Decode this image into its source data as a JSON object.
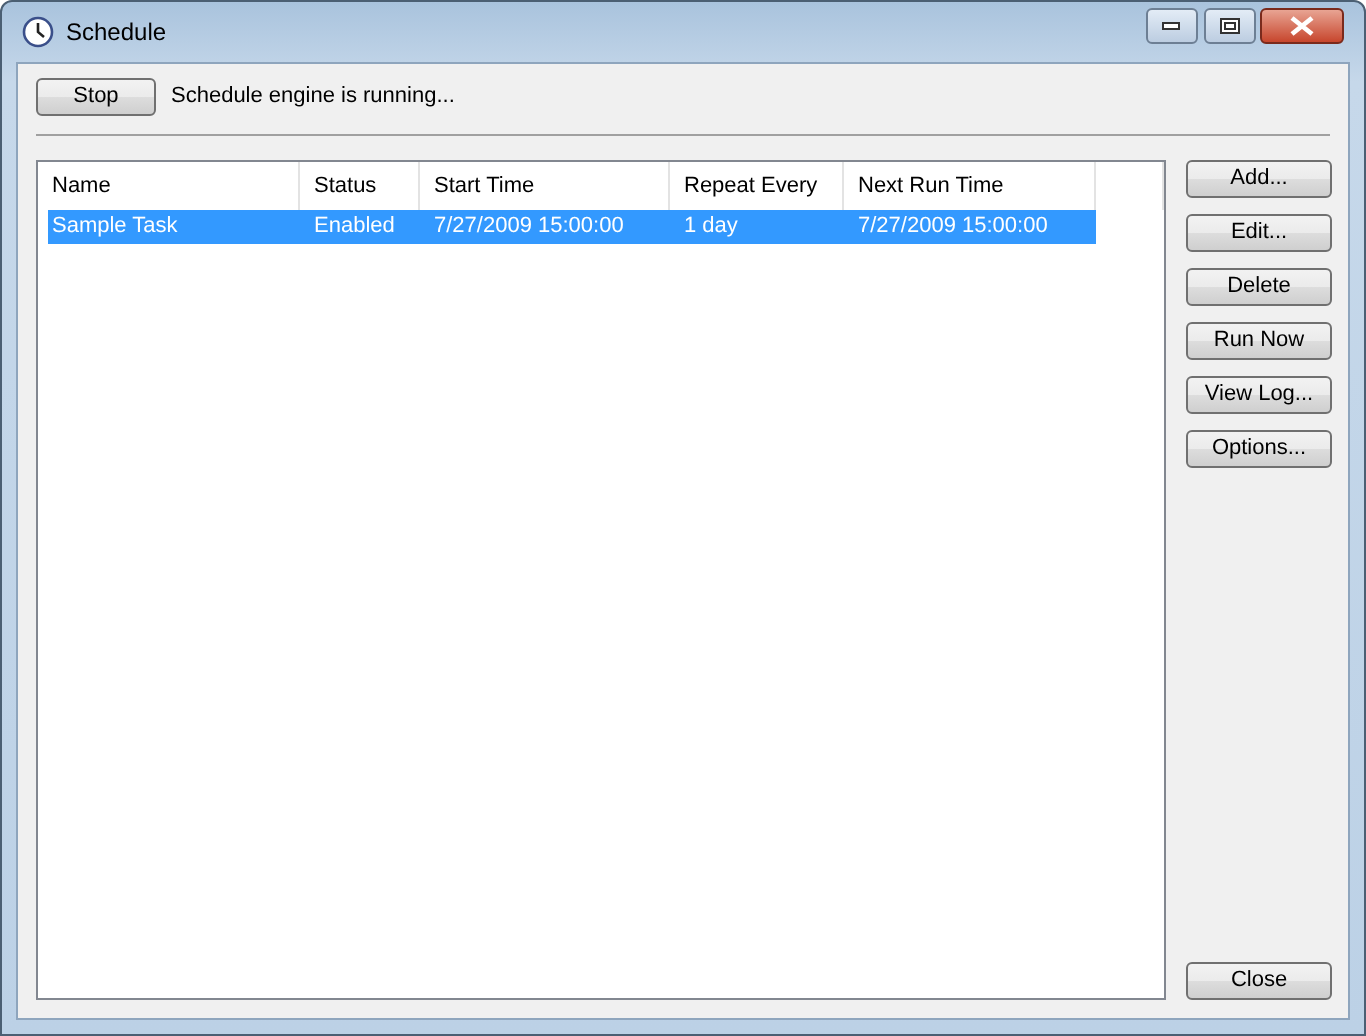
{
  "window": {
    "title": "Schedule"
  },
  "toolbar": {
    "stop_button": "Stop",
    "status": "Schedule engine is running..."
  },
  "table": {
    "columns": [
      "Name",
      "Status",
      "Start Time",
      "Repeat Every",
      "Next Run Time"
    ],
    "rows": [
      {
        "cells": [
          "Sample Task",
          "Enabled",
          "7/27/2009 15:00:00",
          "1 day",
          "7/27/2009 15:00:00"
        ],
        "selected": true
      }
    ]
  },
  "side_buttons": [
    "Add...",
    "Edit...",
    "Delete",
    "Run Now",
    "View Log...",
    "Options..."
  ],
  "close_button": "Close"
}
